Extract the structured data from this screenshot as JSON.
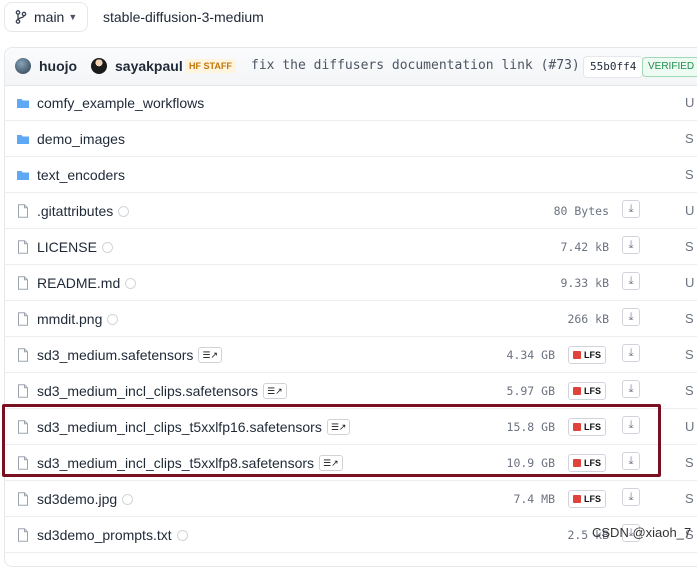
{
  "branch": "main",
  "repo_path": "stable-diffusion-3-medium",
  "commit": {
    "author1": "huojo",
    "author2": "sayakpaul",
    "staff_badge": "HF STAFF",
    "message": "fix the diffusers documentation link (#73)",
    "hash": "55b0ff4",
    "verified": "VERIFIED"
  },
  "files": [
    {
      "name": "comfy_example_workflows",
      "type": "folder",
      "size": "",
      "lfs": false,
      "tail": "U"
    },
    {
      "name": "demo_images",
      "type": "folder",
      "size": "",
      "lfs": false,
      "tail": "S"
    },
    {
      "name": "text_encoders",
      "type": "folder",
      "size": "",
      "lfs": false,
      "tail": "S"
    },
    {
      "name": ".gitattributes",
      "type": "file",
      "size": "80 Bytes",
      "lfs": false,
      "tail": "U"
    },
    {
      "name": "LICENSE",
      "type": "file",
      "size": "7.42 kB",
      "lfs": false,
      "tail": "S"
    },
    {
      "name": "README.md",
      "type": "file",
      "size": "9.33 kB",
      "lfs": false,
      "tail": "U"
    },
    {
      "name": "mmdit.png",
      "type": "file",
      "size": "266 kB",
      "lfs": false,
      "tail": "S"
    },
    {
      "name": "sd3_medium.safetensors",
      "type": "file",
      "size": "4.34 GB",
      "lfs": true,
      "tail": "S"
    },
    {
      "name": "sd3_medium_incl_clips.safetensors",
      "type": "file",
      "size": "5.97 GB",
      "lfs": true,
      "tail": "S"
    },
    {
      "name": "sd3_medium_incl_clips_t5xxlfp16.safetensors",
      "type": "file",
      "size": "15.8 GB",
      "lfs": true,
      "tail": "U"
    },
    {
      "name": "sd3_medium_incl_clips_t5xxlfp8.safetensors",
      "type": "file",
      "size": "10.9 GB",
      "lfs": true,
      "tail": "S"
    },
    {
      "name": "sd3demo.jpg",
      "type": "file",
      "size": "7.4 MB",
      "lfs": true,
      "tail": "S"
    },
    {
      "name": "sd3demo_prompts.txt",
      "type": "file",
      "size": "2.5 kB",
      "lfs": false,
      "tail": "S"
    }
  ],
  "labels": {
    "lfs": "LFS",
    "tag_arrow": "↗",
    "download": "⤓"
  },
  "watermark": "CSDN @xiaoh_7"
}
